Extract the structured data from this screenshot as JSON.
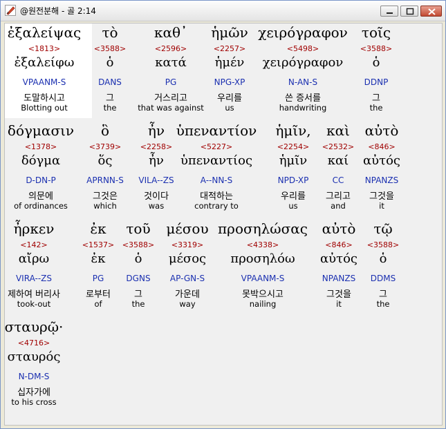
{
  "window": {
    "title": "@원전분해 - 골 2:14",
    "icon": "pencil-icon",
    "minimize_icon": "minimize-icon",
    "maximize_icon": "maximize-icon",
    "close_icon": "close-icon"
  },
  "rows": [
    {
      "words": [
        {
          "greek": "ἐξαλείψας",
          "strong": "<1813>",
          "lemma": "ἐξαλείφω",
          "parse": "VPAANM-S",
          "korean": "도말하시고",
          "english": "Blotting out",
          "selected": true
        },
        {
          "greek": "τὸ",
          "strong": "<3588>",
          "lemma": "ὁ",
          "parse": "DANS",
          "korean": "그",
          "english": "the"
        },
        {
          "greek": "καθ᾽",
          "strong": "<2596>",
          "lemma": "κατά",
          "parse": "PG",
          "korean": "거스리고",
          "english": "that was against"
        },
        {
          "greek": "ἡμῶν",
          "strong": "<2257>",
          "lemma": "ἡμέν",
          "parse": "NPG-XP",
          "korean": "우리를",
          "english": "us"
        },
        {
          "greek": "χειρόγραφον",
          "strong": "<5498>",
          "lemma": "χειρόγραφον",
          "parse": "N-AN-S",
          "korean": "쓴 증서를",
          "english": "handwriting"
        },
        {
          "greek": "τοῖς",
          "strong": "<3588>",
          "lemma": "ὁ",
          "parse": "DDNP",
          "korean": "그",
          "english": "the"
        }
      ]
    },
    {
      "words": [
        {
          "greek": "δόγμασιν",
          "strong": "<1378>",
          "lemma": "δόγμα",
          "parse": "D-DN-P",
          "korean": "의문에",
          "english": "of ordinances"
        },
        {
          "greek": "ὃ",
          "strong": "<3739>",
          "lemma": "ὅς",
          "parse": "APRNN-S",
          "korean": "그것은",
          "english": "which"
        },
        {
          "greek": "ἦν",
          "strong": "<2258>",
          "lemma": "ἦν",
          "parse": "VILA--ZS",
          "korean": "것이다",
          "english": "was"
        },
        {
          "greek": "ὑπεναντίον",
          "strong": "<5227>",
          "lemma": "ὑπεναντίος",
          "parse": "A--NN-S",
          "korean": "대적하는",
          "english": "contrary to"
        },
        {
          "greek": "ἡμῖν,",
          "strong": "<2254>",
          "lemma": "ἡμῖν",
          "parse": "NPD-XP",
          "korean": "우리를",
          "english": "us"
        },
        {
          "greek": "καὶ",
          "strong": "<2532>",
          "lemma": "καί",
          "parse": "CC",
          "korean": "그리고",
          "english": "and"
        },
        {
          "greek": "αὐτὸ",
          "strong": "<846>",
          "lemma": "αὐτός",
          "parse": "NPANZS",
          "korean": "그것을",
          "english": "it"
        }
      ]
    },
    {
      "words": [
        {
          "greek": "ἦρκεν",
          "strong": "<142>",
          "lemma": "αἴρω",
          "parse": "VIRA--ZS",
          "korean": "제하여 버리사",
          "english": "took-out"
        },
        {
          "greek": "ἐκ",
          "strong": "<1537>",
          "lemma": "ἐκ",
          "parse": "PG",
          "korean": "로부터",
          "english": "of"
        },
        {
          "greek": "τοῦ",
          "strong": "<3588>",
          "lemma": "ὁ",
          "parse": "DGNS",
          "korean": "그",
          "english": "the"
        },
        {
          "greek": "μέσου",
          "strong": "<3319>",
          "lemma": "μέσος",
          "parse": "AP-GN-S",
          "korean": "가운데",
          "english": "way"
        },
        {
          "greek": "προσηλώσας",
          "strong": "<4338>",
          "lemma": "προσηλόω",
          "parse": "VPAANM-S",
          "korean": "못박으시고",
          "english": "nailing"
        },
        {
          "greek": "αὐτὸ",
          "strong": "<846>",
          "lemma": "αὐτός",
          "parse": "NPANZS",
          "korean": "그것을",
          "english": "it"
        },
        {
          "greek": "τῷ",
          "strong": "<3588>",
          "lemma": "ὁ",
          "parse": "DDMS",
          "korean": "그",
          "english": "the"
        }
      ]
    },
    {
      "words": [
        {
          "greek": "σταυρῷ·",
          "strong": "<4716>",
          "lemma": "σταυρός",
          "parse": "N-DM-S",
          "korean": "십자가에",
          "english": "to his cross"
        }
      ]
    }
  ]
}
